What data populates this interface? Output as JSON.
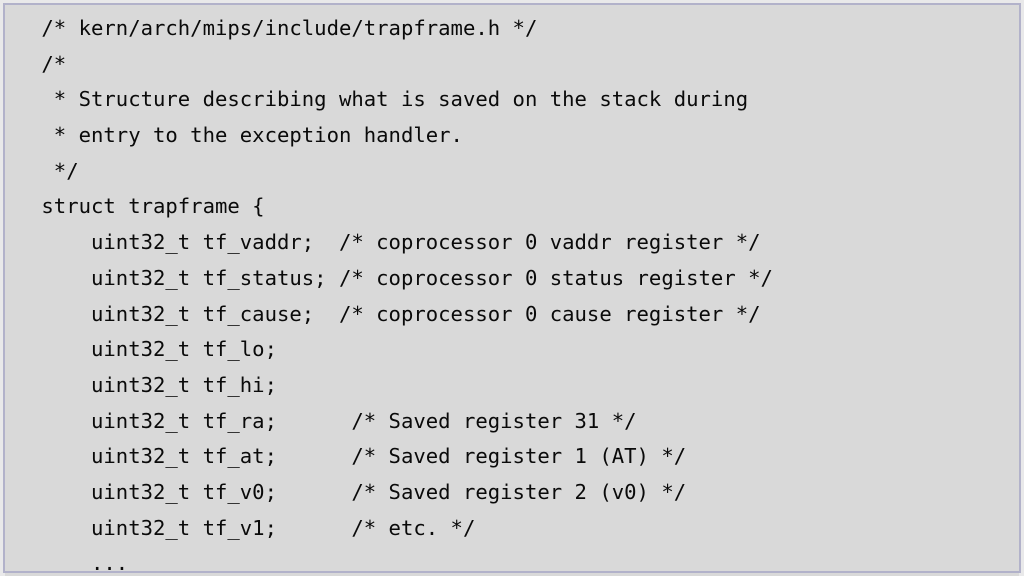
{
  "slide": {
    "kind": "code-slide",
    "background_color": "#d9d9d9",
    "border_color": "#b2b2ca",
    "outer_color": "#e9e9ea",
    "text_color": "#0a0a0a",
    "font_kind": "monospace",
    "language": "c",
    "source_file": "kern/arch/mips/include/trapframe.h"
  },
  "code": {
    "lines": [
      " /* kern/arch/mips/include/trapframe.h */",
      " /*",
      "  * Structure describing what is saved on the stack during",
      "  * entry to the exception handler.",
      "  */",
      " struct trapframe {",
      "     uint32_t tf_vaddr;  /* coprocessor 0 vaddr register */",
      "     uint32_t tf_status; /* coprocessor 0 status register */",
      "     uint32_t tf_cause;  /* coprocessor 0 cause register */",
      "     uint32_t tf_lo;",
      "     uint32_t tf_hi;",
      "     uint32_t tf_ra;      /* Saved register 31 */",
      "     uint32_t tf_at;      /* Saved register 1 (AT) */",
      "     uint32_t tf_v0;      /* Saved register 2 (v0) */",
      "     uint32_t tf_v1;      /* etc. */",
      "     ..."
    ]
  }
}
